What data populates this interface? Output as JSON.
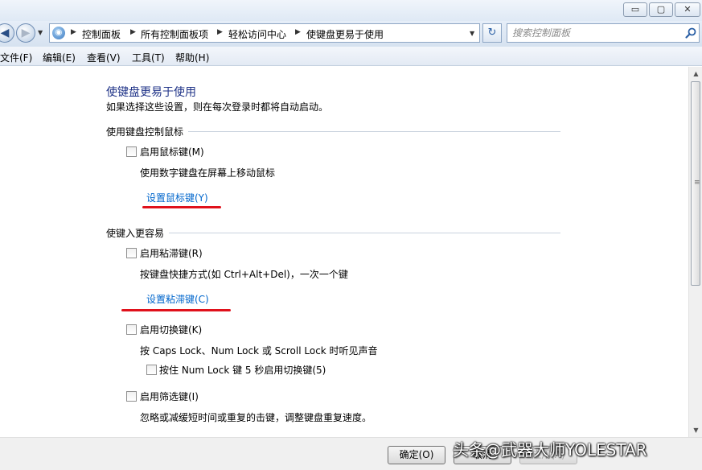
{
  "window": {
    "minimize_symbol": "▭",
    "maximize_symbol": "▢",
    "close_symbol": "✕"
  },
  "nav": {
    "back_symbol": "◀",
    "forward_symbol": "▶",
    "breadcrumbs": [
      "控制面板",
      "所有控制面板项",
      "轻松访问中心",
      "使键盘更易于使用"
    ],
    "search_placeholder": "搜索控制面板"
  },
  "menu": {
    "items": [
      "文件(F)",
      "编辑(E)",
      "查看(V)",
      "工具(T)",
      "帮助(H)"
    ]
  },
  "page": {
    "title": "使键盘更易于使用",
    "subtitle": "如果选择这些设置，则在每次登录时都将自动启动。",
    "sections": [
      {
        "title": "使用键盘控制鼠标",
        "options": [
          {
            "label": "启用鼠标键(M)",
            "checked": false,
            "description": "使用数字键盘在屏幕上移动鼠标",
            "link": "设置鼠标键(Y)"
          }
        ]
      },
      {
        "title": "使键入更容易",
        "options": [
          {
            "label": "启用粘滞键(R)",
            "checked": false,
            "description": "按键盘快捷方式(如 Ctrl+Alt+Del)，一次一个键",
            "link": "设置粘滞键(C)"
          },
          {
            "label": "启用切换键(K)",
            "checked": false,
            "description": "按 Caps Lock、Num Lock 或 Scroll Lock 时听见声音",
            "sub_option": {
              "label": "按住 Num Lock 键 5 秒启用切换键(5)",
              "checked": false
            }
          },
          {
            "label": "启用筛选键(I)",
            "checked": false,
            "description": "忽略或减缓短时间或重复的击键，调整键盘重复速度。"
          }
        ]
      }
    ]
  },
  "buttons": {
    "ok": "确定(O)",
    "cancel": "取消",
    "apply": "应用(A)"
  },
  "watermark": "头条@武器大师YOLESTAR",
  "colors": {
    "heading": "#1e3287",
    "link": "#0066cc",
    "annotation": "#e0111b"
  }
}
